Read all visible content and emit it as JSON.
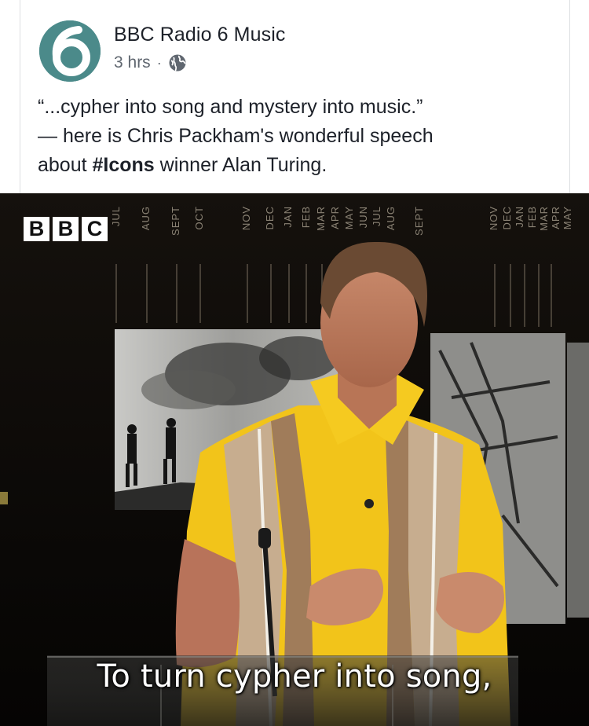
{
  "post": {
    "page_name": "BBC Radio 6 Music",
    "time": "3 hrs",
    "separator": "·",
    "avatar_label": "6",
    "text_line1": "“...cypher into song and mystery into music.”",
    "text_line2": "— here is Chris Packham's wonderful speech",
    "text_line3_pre": "about ",
    "hashtag": "#Icons",
    "text_line3_post": " winner Alan Turing."
  },
  "video": {
    "logo_letters": [
      "B",
      "B",
      "C"
    ],
    "subtitle": "To turn cypher into song,",
    "months_left": [
      "JUL",
      "AUG",
      "SEPT",
      "OCT",
      "NOV",
      "DEC",
      "JAN",
      "FEB",
      "MAR",
      "APR",
      "MAY",
      "JUN",
      "JUL",
      "AUG",
      "SEPT"
    ],
    "months_right": [
      "NOV",
      "DEC",
      "JAN",
      "FEB",
      "MAR",
      "APR",
      "MAY"
    ]
  },
  "icons": {
    "avatar": "radio-6-logo",
    "privacy": "globe-icon"
  },
  "colors": {
    "avatar_bg": "#4b8a8a",
    "shirt": "#f2c41a",
    "link_text": "#1d2129",
    "meta_text": "#606770"
  }
}
